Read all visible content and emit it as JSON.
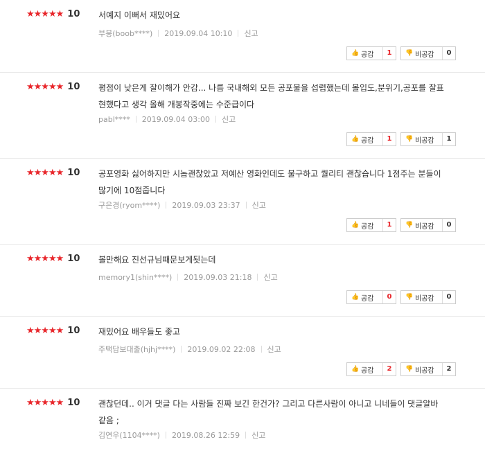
{
  "ui": {
    "like_label": "공감",
    "dislike_label": "비공감",
    "report_label": "신고",
    "star_char": "★★★★★",
    "accent_color": "#e8262b"
  },
  "reviews": [
    {
      "score": "10",
      "text": "서예지 이뻐서 재밌어요",
      "nick": "부붕(boob****)",
      "date": "2019.09.04 10:10",
      "likes": "1",
      "dislikes": "0"
    },
    {
      "score": "10",
      "text": "평점이 낮은게 잘이해가 안감... 나름 국내해외 모든 공포물을 섭렵했는데 몰입도,분위기,공포를 잘표현했다고 생각 올해 개봉작중에는 수준급이다",
      "nick": "pabl****",
      "date": "2019.09.04 03:00",
      "likes": "1",
      "dislikes": "1"
    },
    {
      "score": "10",
      "text": "공포영화 싫어하지만 시놉괜찮았고 저예산 영화인데도 불구하고 퀄리티 괜찮습니다 1점주는 분들이 많기에 10점줍니다",
      "nick": "구은경(ryom****)",
      "date": "2019.09.03 23:37",
      "likes": "1",
      "dislikes": "0"
    },
    {
      "score": "10",
      "text": "볼만해요 진선규님때문보게됫는데",
      "nick": "memory1(shin****)",
      "date": "2019.09.03 21:18",
      "likes": "0",
      "dislikes": "0"
    },
    {
      "score": "10",
      "text": "재밌어요 배우들도 좋고",
      "nick": "주택담보대출(hjhj****)",
      "date": "2019.09.02 22:08",
      "likes": "2",
      "dislikes": "2"
    },
    {
      "score": "10",
      "text": "괜찮던데.. 이거 댓글 다는 사람들 진짜 보긴 한건가? 그리고 다른사람이 아니고 니네들이 댓글알바같음 ;",
      "nick": "김연우(1104****)",
      "date": "2019.08.26 12:59",
      "likes": "",
      "dislikes": ""
    }
  ]
}
